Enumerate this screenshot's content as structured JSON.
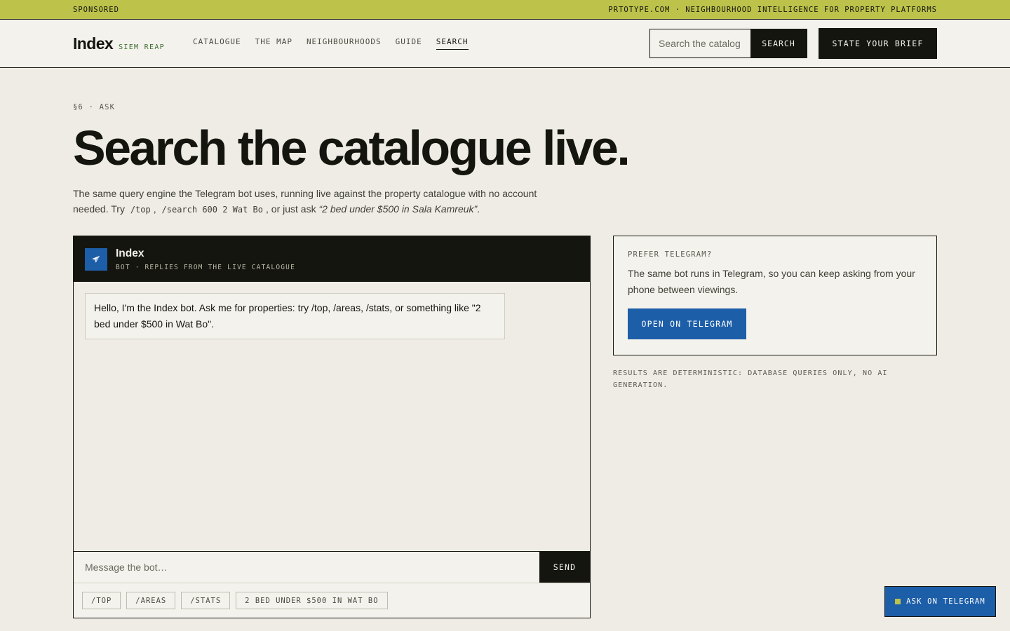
{
  "topbar": {
    "sponsored": "SPONSORED",
    "right": "PRTOTYPE.COM · NEIGHBOURHOOD INTELLIGENCE FOR PROPERTY PLATFORMS"
  },
  "header": {
    "brand": "Index",
    "city": "SIEM REAP",
    "nav": [
      {
        "label": "CATALOGUE"
      },
      {
        "label": "THE MAP"
      },
      {
        "label": "NEIGHBOURHOODS"
      },
      {
        "label": "GUIDE"
      },
      {
        "label": "SEARCH",
        "active": true
      }
    ],
    "search_placeholder": "Search the catalog",
    "search_button": "SEARCH",
    "brief_button": "STATE YOUR BRIEF"
  },
  "hero": {
    "eyebrow": "§6 · ASK",
    "title": "Search the catalogue live.",
    "lede_part1": "The same query engine the Telegram bot uses, running live against the property catalogue with no account needed. Try",
    "code1": "/top",
    "sep1": ",",
    "code2": "/search 600 2 Wat Bo",
    "lede_part2": ", or just ask",
    "example": "“2 bed under $500 in Sala Kamreuk”",
    "lede_end": "."
  },
  "chat": {
    "bot_name": "Index",
    "bot_sub": "BOT · REPLIES FROM THE LIVE CATALOGUE",
    "greeting": "Hello, I'm the Index bot. Ask me for properties: try /top, /areas, /stats, or something like \"2 bed under $500 in Wat Bo\".",
    "input_placeholder": "Message the bot…",
    "send_label": "SEND",
    "chips": [
      "/TOP",
      "/AREAS",
      "/STATS",
      "2 BED UNDER $500 IN WAT BO"
    ]
  },
  "telegram_card": {
    "eyebrow": "PREFER TELEGRAM?",
    "text": "The same bot runs in Telegram, so you can keep asking from your phone between viewings.",
    "button": "OPEN ON TELEGRAM"
  },
  "note": "RESULTS ARE DETERMINISTIC: DATABASE QUERIES ONLY, NO AI GENERATION.",
  "float_button": "ASK ON TELEGRAM",
  "colors": {
    "accent_lime": "#bcc24a",
    "telegram_blue": "#1d5ea8",
    "ink": "#15150f",
    "paper": "#eeece4"
  }
}
